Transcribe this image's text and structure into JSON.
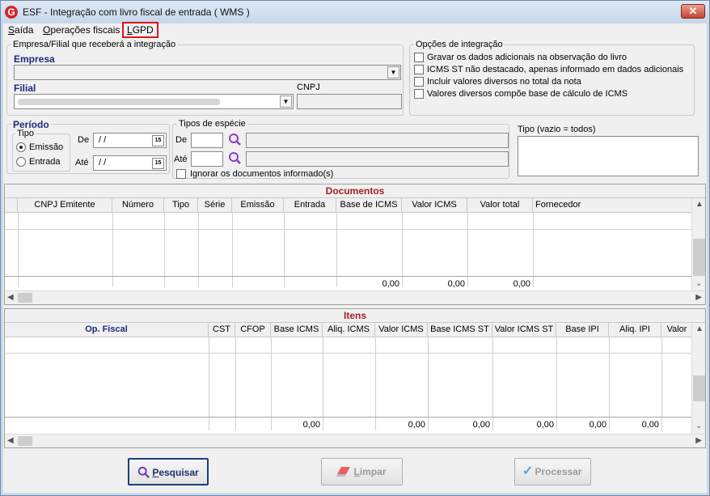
{
  "window": {
    "title": "ESF - Integração com livro fiscal de entrada ( WMS )",
    "close_label": "✕"
  },
  "menu": {
    "items": [
      {
        "label": "Saída",
        "accel": "S",
        "rest": "aída"
      },
      {
        "label": "Operações fiscais",
        "accel": "O",
        "rest": "perações fiscais"
      },
      {
        "label": "LGPD",
        "accel": "L",
        "rest": "GPD"
      }
    ]
  },
  "empresa_group": {
    "title": "Empresa/Filial que receberá a integração",
    "empresa_label": "Empresa",
    "empresa_value": "",
    "filial_label": "Filial",
    "filial_value": "",
    "cnpj_label": "CNPJ",
    "cnpj_value": ""
  },
  "opcoes_group": {
    "title": "Opções de integração",
    "options": [
      {
        "label": "Gravar os dados adicionais na observação do livro",
        "checked": false
      },
      {
        "label": "ICMS ST  não destacado, apenas informado em dados adicionais",
        "checked": false
      },
      {
        "label": "Incluir valores diversos no total da nota",
        "checked": false
      },
      {
        "label": "Valores diversos compõe base de cálculo de ICMS",
        "checked": false
      }
    ]
  },
  "periodo_group": {
    "title": "Período",
    "tipo_label": "Tipo",
    "radio_emissao": "Emissão",
    "radio_entrada": "Entrada",
    "selected": "Emissão",
    "de_label": "De",
    "de_value": "/ /",
    "ate_label": "Até",
    "ate_value": "/ /",
    "cal_icon": "15"
  },
  "especie_group": {
    "title": "Tipos de espécie",
    "de_label": "De",
    "ate_label": "Até",
    "de_code": "",
    "ate_code": "",
    "ignorar_label": "Ignorar os documentos informado(s)",
    "tipo_label": "Tipo (vazio = todos)",
    "tipo_value": ""
  },
  "documentos": {
    "title": "Documentos",
    "columns": [
      "CNPJ Emitente",
      "Número",
      "Tipo",
      "Série",
      "Emissão",
      "Entrada",
      "Base de ICMS",
      "Valor ICMS",
      "Valor total",
      "Fornecedor"
    ],
    "totals": {
      "base_icms": "0,00",
      "valor_icms": "0,00",
      "valor_total": "0,00"
    }
  },
  "itens": {
    "title": "Itens",
    "columns": [
      "Op. Fiscal",
      "CST",
      "CFOP",
      "Base ICMS",
      "Aliq. ICMS",
      "Valor ICMS",
      "Base ICMS ST",
      "Valor ICMS ST",
      "Base IPI",
      "Aliq. IPI",
      "Valor"
    ],
    "totals": {
      "base_icms": "0,00",
      "valor_icms": "0,00",
      "base_icms_st": "0,00",
      "valor_icms_st": "0,00",
      "base_ipi": "0,00",
      "aliq_ipi": "0,00"
    }
  },
  "buttons": {
    "pesquisar": {
      "accel": "P",
      "rest": "esquisar"
    },
    "limpar": {
      "accel": "L",
      "rest": "impar"
    },
    "processar": {
      "label": "Processar"
    }
  },
  "colors": {
    "accent": "#1c2a7a",
    "section_title": "#a51f1f",
    "highlight": "#e1141b"
  }
}
